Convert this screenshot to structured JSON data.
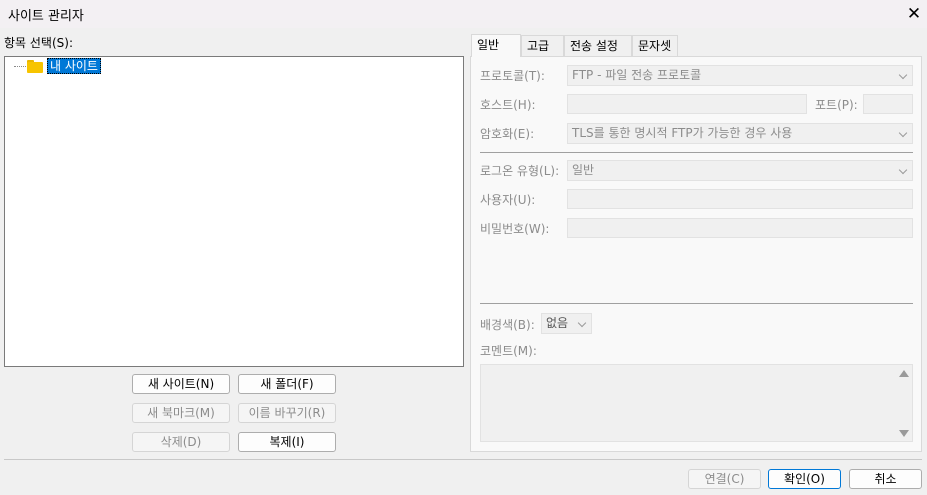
{
  "window": {
    "title": "사이트 관리자",
    "close_glyph": "✕"
  },
  "left": {
    "label": "항목 선택(S):",
    "tree": {
      "root": "내 사이트"
    },
    "buttons": {
      "new_site": "새 사이트(N)",
      "new_folder": "새 폴더(F)",
      "new_bookmark": "새 북마크(M)",
      "rename": "이름 바꾸기(R)",
      "delete": "삭제(D)",
      "duplicate": "복제(I)"
    }
  },
  "tabs": [
    "일반",
    "고급",
    "전송 설정",
    "문자셋"
  ],
  "general": {
    "protocol_label": "프로토콜(T):",
    "protocol_value": "FTP - 파일 전송 프로토콜",
    "host_label": "호스트(H):",
    "port_label": "포트(P):",
    "encryption_label": "암호화(E):",
    "encryption_value": "TLS를 통한 명시적 FTP가 가능한 경우 사용",
    "logon_label": "로그온 유형(L):",
    "logon_value": "일반",
    "user_label": "사용자(U):",
    "password_label": "비밀번호(W):",
    "bgcolor_label": "배경색(B):",
    "bgcolor_value": "없음",
    "comments_label": "코멘트(M):"
  },
  "footer": {
    "connect": "연결(C)",
    "ok": "확인(O)",
    "cancel": "취소"
  },
  "colors": {
    "selection": "#0078d7",
    "folder": "#f7c400"
  }
}
